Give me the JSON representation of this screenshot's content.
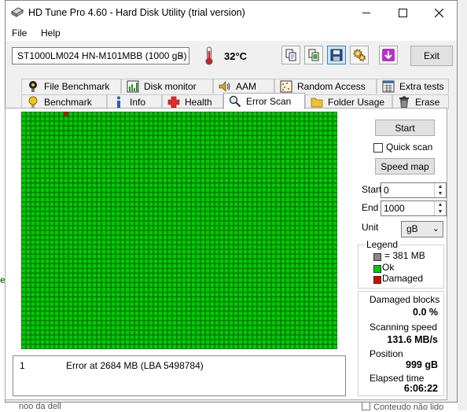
{
  "window": {
    "title": "HD Tune Pro 4.60 - Hard Disk Utility (trial version)"
  },
  "menu": {
    "file": "File",
    "help": "Help"
  },
  "toolbar": {
    "drive": "ST1000LM024 HN-M101MBB (1000 gB)",
    "temperature": "32°C",
    "exit_label": "Exit"
  },
  "tabs": {
    "row1": [
      "File Benchmark",
      "Disk monitor",
      "AAM",
      "Random Access",
      "Extra tests"
    ],
    "row2": [
      "Benchmark",
      "Info",
      "Health",
      "Error Scan",
      "Folder Usage",
      "Erase"
    ],
    "selected": "Error Scan"
  },
  "scan": {
    "grid_cols": 67,
    "grid_rows": 50,
    "damaged_blocks": [
      [
        9,
        0
      ]
    ],
    "colors": {
      "ok": "#00cc00",
      "damaged": "#dd0000",
      "gridline": "#006600"
    }
  },
  "log": {
    "number": "1",
    "message": "Error at 2684 MB (LBA 5498784)"
  },
  "controls": {
    "start_label": "Start",
    "quick_scan_label": "Quick scan",
    "quick_scan_checked": false,
    "speed_map_label": "Speed map",
    "start_field_label": "Start",
    "start_value": "0",
    "end_field_label": "End",
    "end_value": "1000",
    "unit_label": "Unit",
    "unit_value": "gB"
  },
  "legend": {
    "title": "Legend",
    "block_size": "= 381 MB",
    "ok": "Ok",
    "damaged": "Damaged"
  },
  "stats": {
    "damaged_blocks_label": "Damaged blocks",
    "damaged_blocks_value": "0.0 %",
    "scanning_speed_label": "Scanning speed",
    "scanning_speed_value": "131.6 MB/s",
    "position_label": "Position",
    "position_value": "999 gB",
    "elapsed_label": "Elapsed time",
    "elapsed_value": "6:06:22"
  },
  "background": {
    "left_text": "noo da dell",
    "right_text": "Conteudo não lido",
    "left_marker": "e"
  }
}
